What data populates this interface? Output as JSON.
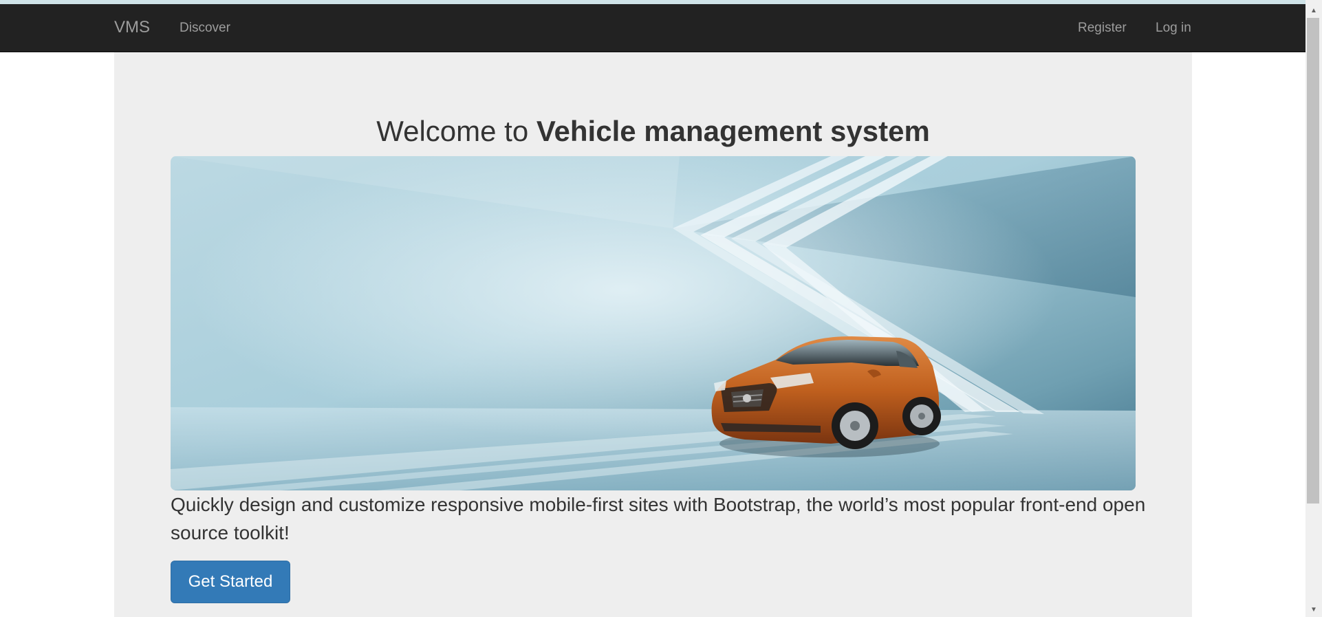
{
  "navbar": {
    "brand": "VMS",
    "links": [
      {
        "label": "Discover"
      },
      {
        "label": "Register"
      },
      {
        "label": "Log in"
      }
    ]
  },
  "jumbotron": {
    "title_prefix": "Welcome to ",
    "title_bold": "Vehicle management system",
    "lead": "Quickly design and customize responsive mobile-first sites with Bootstrap, the world’s most popular front-end open source toolkit!",
    "cta_label": "Get Started"
  },
  "colors": {
    "navbar_bg": "#222222",
    "nav_text": "#9d9d9d",
    "jumbotron_bg": "#eeeeee",
    "primary_button": "#337ab7",
    "car_body": "#c0601e"
  },
  "icons": {
    "scroll_up": "scroll-up-arrow",
    "scroll_down": "scroll-down-arrow"
  }
}
